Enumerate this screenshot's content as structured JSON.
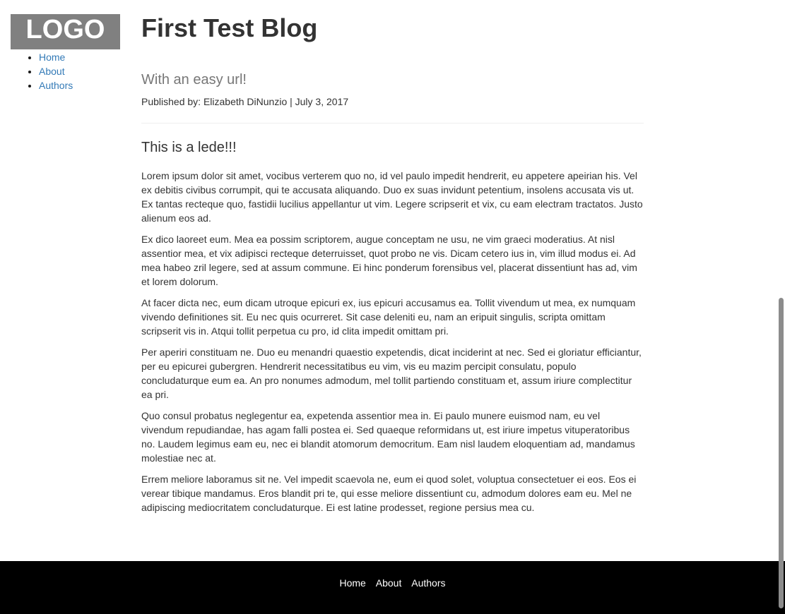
{
  "logo": {
    "text": "LOGO"
  },
  "sidebar": {
    "items": [
      {
        "label": "Home"
      },
      {
        "label": "About"
      },
      {
        "label": "Authors"
      }
    ]
  },
  "article": {
    "title": "First Test Blog",
    "subtitle": "With an easy url!",
    "byline": "Published by: Elizabeth DiNunzio | July 3, 2017",
    "lede": "This is a lede!!!",
    "paragraphs": [
      "Lorem ipsum dolor sit amet, vocibus verterem quo no, id vel paulo impedit hendrerit, eu appetere apeirian his. Vel ex debitis civibus corrumpit, qui te accusata aliquando. Duo ex suas invidunt petentium, insolens accusata vis ut. Ex tantas recteque quo, fastidii lucilius appellantur ut vim. Legere scripserit et vix, cu eam electram tractatos. Justo alienum eos ad.",
      "Ex dico laoreet eum. Mea ea possim scriptorem, augue conceptam ne usu, ne vim graeci moderatius. At nisl assentior mea, et vix adipisci recteque deterruisset, quot probo ne vis. Dicam cetero ius in, vim illud modus ei. Ad mea habeo zril legere, sed at assum commune. Ei hinc ponderum forensibus vel, placerat dissentiunt has ad, vim et lorem dolorum.",
      "At facer dicta nec, eum dicam utroque epicuri ex, ius epicuri accusamus ea. Tollit vivendum ut mea, ex numquam vivendo definitiones sit. Eu nec quis ocurreret. Sit case deleniti eu, nam an eripuit singulis, scripta omittam scripserit vis in. Atqui tollit perpetua cu pro, id clita impedit omittam pri.",
      "Per aperiri constituam ne. Duo eu menandri quaestio expetendis, dicat inciderint at nec. Sed ei gloriatur efficiantur, per eu epicurei gubergren. Hendrerit necessitatibus eu vim, vis eu mazim percipit consulatu, populo concludaturque eum ea. An pro nonumes admodum, mel tollit partiendo constituam et, assum iriure complectitur ea pri.",
      "Quo consul probatus neglegentur ea, expetenda assentior mea in. Ei paulo munere euismod nam, eu vel vivendum repudiandae, has agam falli postea ei. Sed quaeque reformidans ut, est iriure impetus vituperatoribus no. Laudem legimus eam eu, nec ei blandit atomorum democritum. Eam nisl laudem eloquentiam ad, mandamus molestiae nec at.",
      "Errem meliore laboramus sit ne. Vel impedit scaevola ne, eum ei quod solet, voluptua consectetuer ei eos. Eos ei verear tibique mandamus. Eros blandit pri te, qui esse meliore dissentiunt cu, admodum dolores eam eu. Mel ne adipiscing mediocritatem concludaturque. Ei est latine prodesset, regione persius mea cu."
    ]
  },
  "footer": {
    "items": [
      {
        "label": "Home"
      },
      {
        "label": "About"
      },
      {
        "label": "Authors"
      }
    ]
  },
  "colors": {
    "link": "#337ab7",
    "logo_bg": "#808080",
    "footer_bg": "#000000",
    "footer_link": "#ffffff",
    "subtitle": "#777777",
    "text": "#333333"
  }
}
